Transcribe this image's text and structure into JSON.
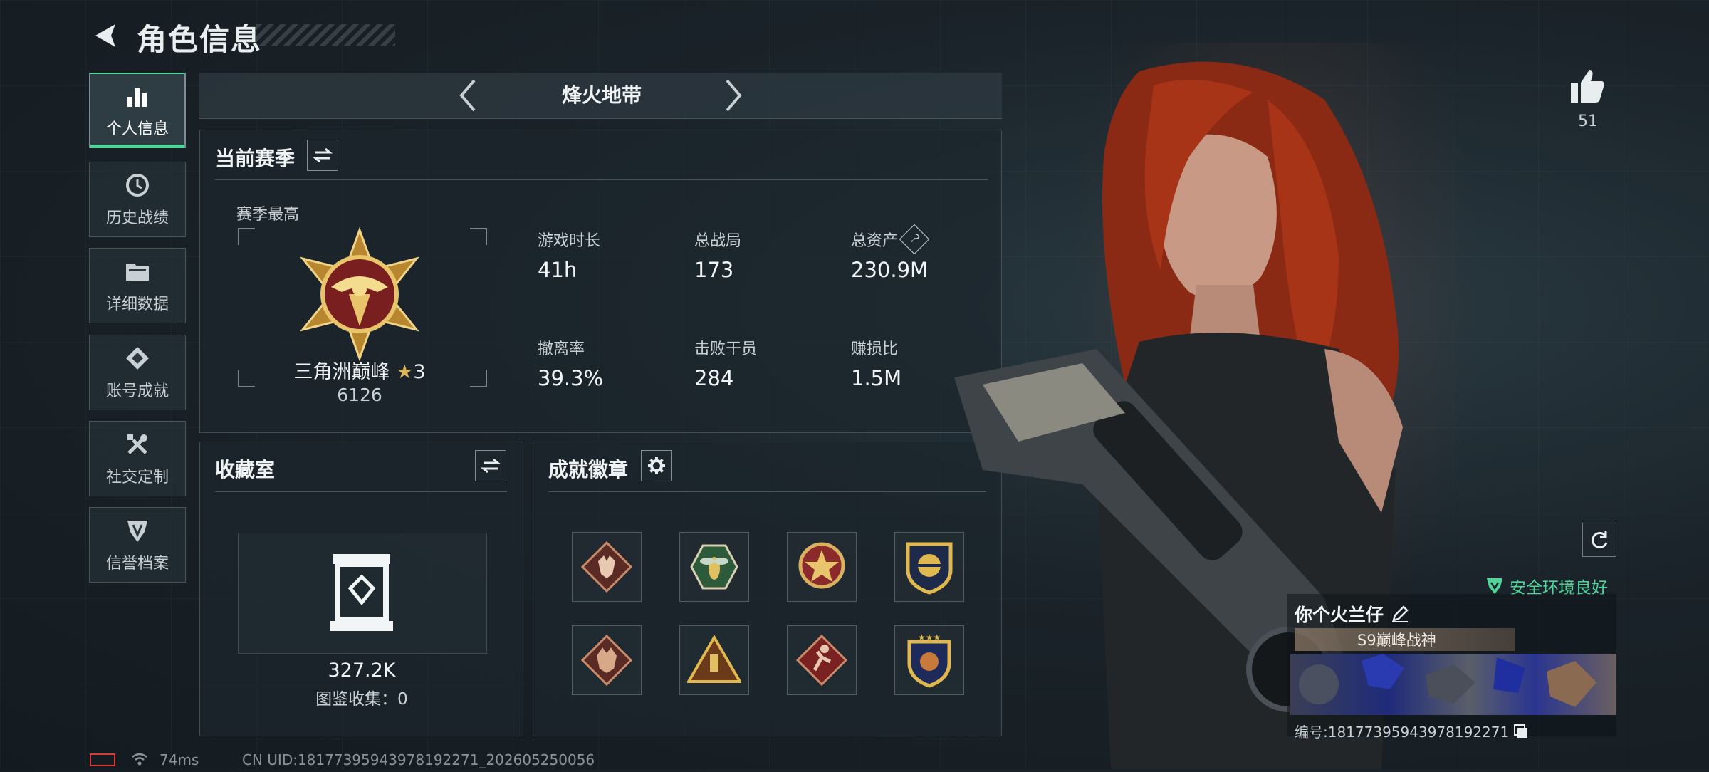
{
  "header": {
    "title": "角色信息"
  },
  "sidebar": {
    "items": [
      {
        "label": "个人信息",
        "icon": "bar-chart-icon",
        "active": true
      },
      {
        "label": "历史战绩",
        "icon": "history-clock-icon"
      },
      {
        "label": "详细数据",
        "icon": "folder-icon"
      },
      {
        "label": "账号成就",
        "icon": "diamond-achievement-icon"
      },
      {
        "label": "社交定制",
        "icon": "tools-icon"
      },
      {
        "label": "信誉档案",
        "icon": "shield-icon"
      }
    ]
  },
  "mode": {
    "name": "烽火地带"
  },
  "season": {
    "title": "当前赛季",
    "best_label": "赛季最高",
    "rank_name": "三角洲巅峰",
    "rank_stars": "3",
    "rank_score": "6126",
    "stats": [
      {
        "label": "游戏时长",
        "value": "41h"
      },
      {
        "label": "总战局",
        "value": "173"
      },
      {
        "label": "总资产",
        "value": "230.9M",
        "help": "?"
      },
      {
        "label": "撤离率",
        "value": "39.3%"
      },
      {
        "label": "击败干员",
        "value": "284"
      },
      {
        "label": "赚损比",
        "value": "1.5M"
      }
    ]
  },
  "collection": {
    "title": "收藏室",
    "value": "327.2K",
    "catalog_label": "图鉴收集：0"
  },
  "achievements": {
    "title": "成就徽章",
    "badges": [
      "wolf-badge-icon",
      "wasp-badge-icon",
      "star-badge-icon",
      "shield-gold-badge-icon",
      "dragon-badge-icon",
      "pyramid-badge-icon",
      "runner-badge-icon",
      "eagle-badge-icon"
    ]
  },
  "likes": {
    "count": "51"
  },
  "player": {
    "name": "你个火兰仔",
    "title_badge": "S9巅峰战神",
    "safety": "安全环境良好",
    "id_label": "编号:18177395943978192271"
  },
  "footer": {
    "ping": "74ms",
    "uid": "CN UID:18177395943978192271_202605250056"
  },
  "colors": {
    "accent": "#4fd49a",
    "panel_bg": "#1c262c",
    "gold": "#c9a24a"
  }
}
